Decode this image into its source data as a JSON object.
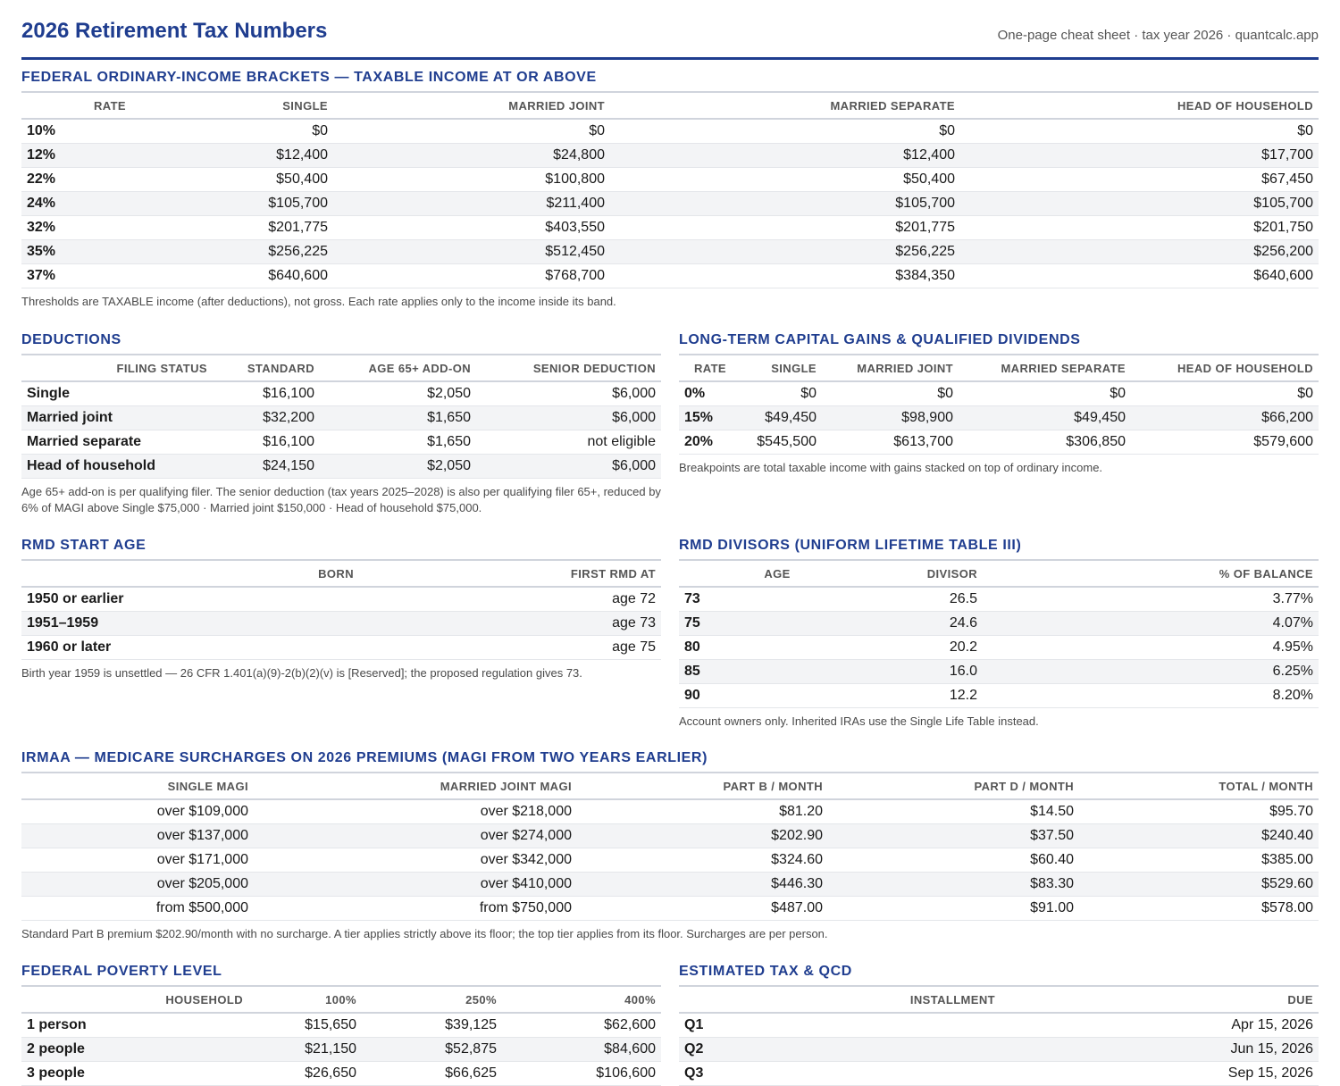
{
  "header": {
    "title": "2026 Retirement Tax Numbers",
    "subtitle": "One-page cheat sheet · tax year 2026 · quantcalc.app"
  },
  "brackets": {
    "title": "FEDERAL ORDINARY-INCOME BRACKETS — TAXABLE INCOME AT OR ABOVE",
    "columns": [
      "RATE",
      "SINGLE",
      "MARRIED JOINT",
      "MARRIED SEPARATE",
      "HEAD OF HOUSEHOLD"
    ],
    "rows": [
      [
        "10%",
        "$0",
        "$0",
        "$0",
        "$0"
      ],
      [
        "12%",
        "$12,400",
        "$24,800",
        "$12,400",
        "$17,700"
      ],
      [
        "22%",
        "$50,400",
        "$100,800",
        "$50,400",
        "$67,450"
      ],
      [
        "24%",
        "$105,700",
        "$211,400",
        "$105,700",
        "$105,700"
      ],
      [
        "32%",
        "$201,775",
        "$403,550",
        "$201,775",
        "$201,750"
      ],
      [
        "35%",
        "$256,225",
        "$512,450",
        "$256,225",
        "$256,200"
      ],
      [
        "37%",
        "$640,600",
        "$768,700",
        "$384,350",
        "$640,600"
      ]
    ],
    "note": "Thresholds are TAXABLE income (after deductions), not gross. Each rate applies only to the income inside its band."
  },
  "deductions": {
    "title": "DEDUCTIONS",
    "columns": [
      "FILING STATUS",
      "STANDARD",
      "AGE 65+ ADD-ON",
      "SENIOR DEDUCTION"
    ],
    "rows": [
      [
        "Single",
        "$16,100",
        "$2,050",
        "$6,000"
      ],
      [
        "Married joint",
        "$32,200",
        "$1,650",
        "$6,000"
      ],
      [
        "Married separate",
        "$16,100",
        "$1,650",
        "not eligible"
      ],
      [
        "Head of household",
        "$24,150",
        "$2,050",
        "$6,000"
      ]
    ],
    "note": "Age 65+ add-on is per qualifying filer. The senior deduction (tax years 2025–2028) is also per qualifying filer 65+, reduced by 6% of MAGI above Single $75,000 · Married joint $150,000 · Head of household $75,000."
  },
  "capgains": {
    "title": "LONG-TERM CAPITAL GAINS & QUALIFIED DIVIDENDS",
    "columns": [
      "RATE",
      "SINGLE",
      "MARRIED JOINT",
      "MARRIED SEPARATE",
      "HEAD OF HOUSEHOLD"
    ],
    "rows": [
      [
        "0%",
        "$0",
        "$0",
        "$0",
        "$0"
      ],
      [
        "15%",
        "$49,450",
        "$98,900",
        "$49,450",
        "$66,200"
      ],
      [
        "20%",
        "$545,500",
        "$613,700",
        "$306,850",
        "$579,600"
      ]
    ],
    "note": "Breakpoints are total taxable income with gains stacked on top of ordinary income."
  },
  "rmd_age": {
    "title": "RMD START AGE",
    "columns": [
      "BORN",
      "FIRST RMD AT"
    ],
    "rows": [
      [
        "1950 or earlier",
        "age 72"
      ],
      [
        "1951–1959",
        "age 73"
      ],
      [
        "1960 or later",
        "age 75"
      ]
    ],
    "note": "Birth year 1959 is unsettled — 26 CFR 1.401(a)(9)-2(b)(2)(v) is [Reserved]; the proposed regulation gives 73."
  },
  "rmd_divisors": {
    "title": "RMD DIVISORS (UNIFORM LIFETIME TABLE III)",
    "columns": [
      "AGE",
      "DIVISOR",
      "% OF BALANCE"
    ],
    "rows": [
      [
        "73",
        "26.5",
        "3.77%"
      ],
      [
        "75",
        "24.6",
        "4.07%"
      ],
      [
        "80",
        "20.2",
        "4.95%"
      ],
      [
        "85",
        "16.0",
        "6.25%"
      ],
      [
        "90",
        "12.2",
        "8.20%"
      ]
    ],
    "note": "Account owners only. Inherited IRAs use the Single Life Table instead."
  },
  "irmaa": {
    "title": "IRMAA — MEDICARE SURCHARGES ON 2026 PREMIUMS (MAGI FROM TWO YEARS EARLIER)",
    "columns": [
      "SINGLE MAGI",
      "MARRIED JOINT MAGI",
      "PART B / MONTH",
      "PART D / MONTH",
      "TOTAL / MONTH"
    ],
    "rows": [
      [
        "over $109,000",
        "over $218,000",
        "$81.20",
        "$14.50",
        "$95.70"
      ],
      [
        "over $137,000",
        "over $274,000",
        "$202.90",
        "$37.50",
        "$240.40"
      ],
      [
        "over $171,000",
        "over $342,000",
        "$324.60",
        "$60.40",
        "$385.00"
      ],
      [
        "over $205,000",
        "over $410,000",
        "$446.30",
        "$83.30",
        "$529.60"
      ],
      [
        "from $500,000",
        "from $750,000",
        "$487.00",
        "$91.00",
        "$578.00"
      ]
    ],
    "note": "Standard Part B premium $202.90/month with no surcharge. A tier applies strictly above its floor; the top tier applies from its floor. Surcharges are per person."
  },
  "poverty": {
    "title": "FEDERAL POVERTY LEVEL",
    "columns": [
      "HOUSEHOLD",
      "100%",
      "250%",
      "400%"
    ],
    "rows": [
      [
        "1 person",
        "$15,650",
        "$39,125",
        "$62,600"
      ],
      [
        "2 people",
        "$21,150",
        "$52,875",
        "$84,600"
      ],
      [
        "3 people",
        "$26,650",
        "$66,625",
        "$106,600"
      ]
    ]
  },
  "estimated": {
    "title": "ESTIMATED TAX & QCD",
    "columns": [
      "INSTALLMENT",
      "DUE"
    ],
    "rows": [
      [
        "Q1",
        "Apr 15, 2026"
      ],
      [
        "Q2",
        "Jun 15, 2026"
      ],
      [
        "Q3",
        "Sep 15, 2026"
      ]
    ]
  }
}
